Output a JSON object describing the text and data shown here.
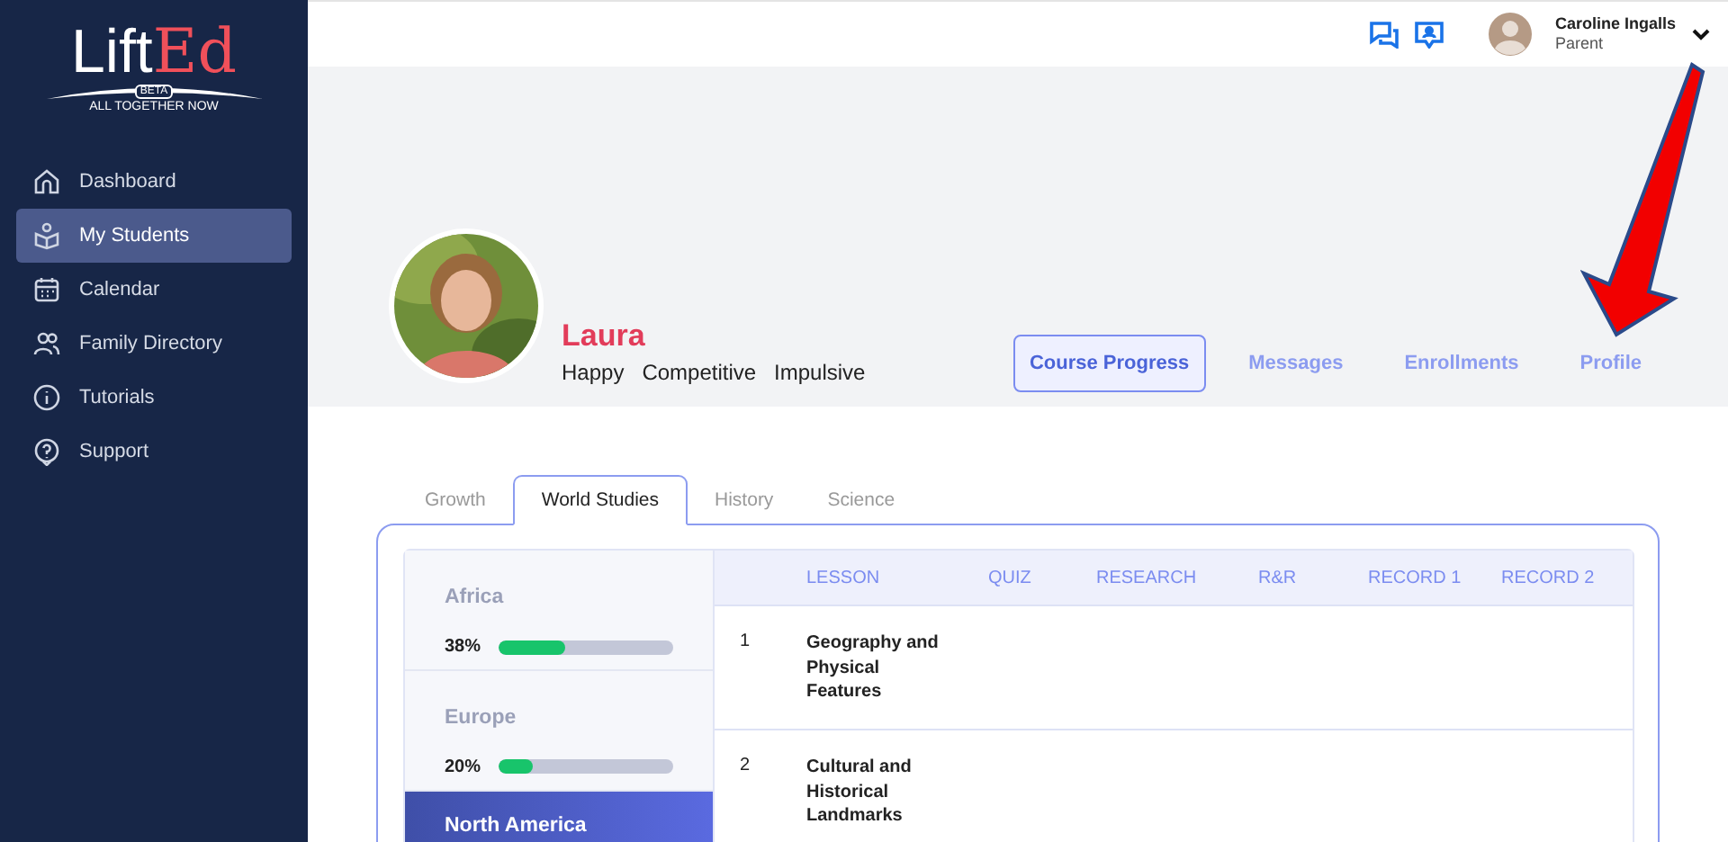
{
  "sidebar": {
    "logo": {
      "word_1": "Lift",
      "word_2": "Ed",
      "badge": "BETA",
      "tagline": "ALL TOGETHER NOW"
    },
    "items": [
      {
        "label": "Dashboard",
        "selected": false
      },
      {
        "label": "My Students",
        "selected": true
      },
      {
        "label": "Calendar",
        "selected": false
      },
      {
        "label": "Family Directory",
        "selected": false
      },
      {
        "label": "Tutorials",
        "selected": false
      },
      {
        "label": "Support",
        "selected": false
      }
    ]
  },
  "topbar": {
    "user": {
      "name": "Caroline Ingalls",
      "role": "Parent"
    }
  },
  "student": {
    "name": "Laura",
    "traits": [
      "Happy",
      "Competitive",
      "Impulsive"
    ]
  },
  "profile_tabs": [
    {
      "label": "Course Progress",
      "selected": true
    },
    {
      "label": "Messages",
      "selected": false
    },
    {
      "label": "Enrollments",
      "selected": false
    },
    {
      "label": "Profile",
      "selected": false
    }
  ],
  "subject_tabs": [
    {
      "label": "Growth",
      "selected": false
    },
    {
      "label": "World Studies",
      "selected": true
    },
    {
      "label": "History",
      "selected": false
    },
    {
      "label": "Science",
      "selected": false
    }
  ],
  "regions": [
    {
      "name": "Africa",
      "percent": "38%",
      "level": 0.38,
      "selected": false
    },
    {
      "name": "Europe",
      "percent": "20%",
      "level": 0.2,
      "selected": false
    },
    {
      "name": "North America",
      "selected": true
    }
  ],
  "table": {
    "columns": [
      "LESSON",
      "QUIZ",
      "RESEARCH",
      "R&R",
      "RECORD 1",
      "RECORD 2"
    ],
    "rows": [
      {
        "number": "1",
        "lesson": "Geography and Physical Features"
      },
      {
        "number": "2",
        "lesson": "Cultural and Historical Landmarks"
      }
    ]
  }
}
